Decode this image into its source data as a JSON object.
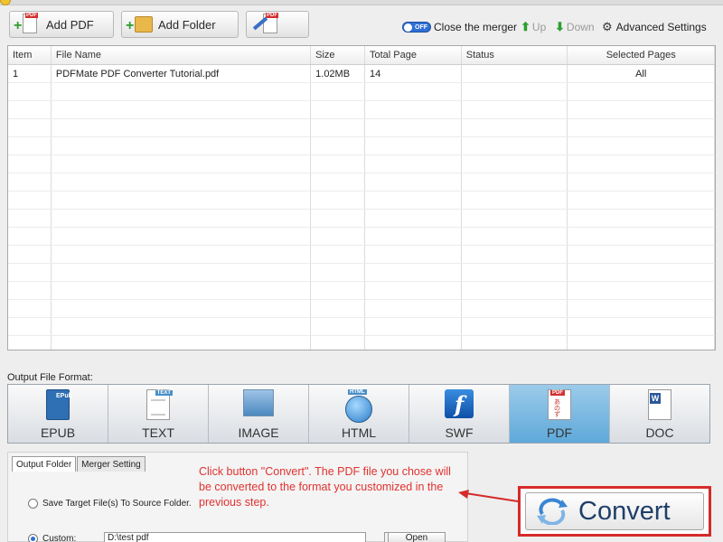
{
  "toolbar": {
    "add_pdf_label": "Add PDF",
    "add_folder_label": "Add Folder",
    "edit_icon": "pdf-edit-icon",
    "pdf_tag": "PDF"
  },
  "right_tools": {
    "toggle_state": "OFF",
    "close_merger_label": "Close the merger",
    "up_label": "Up",
    "down_label": "Down",
    "advanced_settings_label": "Advanced Settings"
  },
  "table": {
    "headers": [
      "Item",
      "File Name",
      "Size",
      "Total Page",
      "Status",
      "Selected Pages"
    ],
    "rows": [
      {
        "item": "1",
        "file_name": "PDFMate PDF Converter Tutorial.pdf",
        "size": "1.02MB",
        "total_page": "14",
        "status": "",
        "selected_pages": "All"
      }
    ]
  },
  "output_format": {
    "label": "Output File Format:",
    "formats": [
      "EPUB",
      "TEXT",
      "IMAGE",
      "HTML",
      "SWF",
      "PDF",
      "DOC"
    ],
    "selected": "PDF",
    "icon_tags": {
      "epub": "EPub",
      "text": "TEXT",
      "html": "HTML",
      "pdf": "PDF",
      "doc": "W"
    }
  },
  "settings": {
    "tabs": [
      "Output Folder",
      "Merger Setting"
    ],
    "active_tab": "Output Folder",
    "save_to_source_label": "Save Target File(s) To Source Folder.",
    "custom_label": "Custom:",
    "custom_path": "D:\\test pdf",
    "browse_label": "...",
    "open_label": "Open"
  },
  "annotation": {
    "text": "Click button \"Convert\". The PDF file you chose will be converted to the format you customized in the previous step.",
    "color": "#e0322f"
  },
  "convert": {
    "label": "Convert",
    "highlight_color": "#d62a2a"
  }
}
